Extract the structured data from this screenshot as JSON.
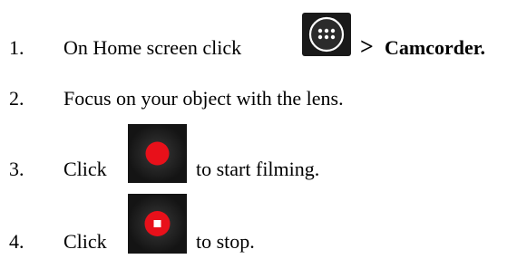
{
  "steps": [
    {
      "number": "1.",
      "text": "On Home screen click",
      "icon": "apps-grid-icon",
      "arrow": ">",
      "target": "Camcorder."
    },
    {
      "number": "2.",
      "text": "Focus on your object with the lens."
    },
    {
      "number": "3.",
      "text_before": "Click",
      "icon": "record-start-icon",
      "text_after": "to start filming."
    },
    {
      "number": "4.",
      "text_before": "Click",
      "icon": "record-stop-icon",
      "text_after": "to stop."
    }
  ],
  "colors": {
    "record_red": "#e8101a",
    "icon_bg": "#1a1a1a"
  }
}
